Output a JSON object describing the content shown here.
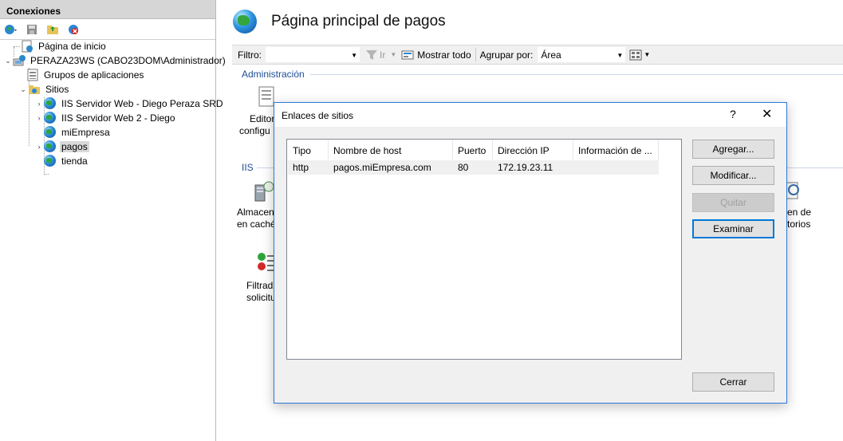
{
  "connections": {
    "header": "Conexiones",
    "tree": [
      {
        "label": "Página de inicio"
      },
      {
        "label": "PERAZA23WS (CABO23DOM\\Administrador)"
      },
      {
        "label": "Grupos de aplicaciones"
      },
      {
        "label": "Sitios"
      },
      {
        "label": "IIS Servidor Web - Diego Peraza SRD"
      },
      {
        "label": "IIS Servidor Web 2 - Diego"
      },
      {
        "label": "miEmpresa"
      },
      {
        "label": "pagos"
      },
      {
        "label": "tienda"
      }
    ]
  },
  "main": {
    "title": "Página principal de pagos",
    "filter_label": "Filtro:",
    "go_label": "Ir",
    "show_all_label": "Mostrar todo",
    "group_by_label": "Agrupar por:",
    "group_by_value": "Área",
    "sections": {
      "admin": "Administración",
      "iis": "IIS"
    },
    "features": {
      "editor_1": "Editor",
      "editor_2": "configu",
      "cache_1": "Almacen",
      "cache_2": "en caché",
      "filter_1": "Filtrad",
      "filter_2": "solicitu",
      "dir_1": "en de",
      "dir_2": "torios"
    }
  },
  "dialog": {
    "title": "Enlaces de sitios",
    "help": "?",
    "close": "✕",
    "columns": [
      "Tipo",
      "Nombre de host",
      "Puerto",
      "Dirección IP",
      "Información de ..."
    ],
    "rows": [
      [
        "http",
        "pagos.miEmpresa.com",
        "80",
        "172.19.23.11",
        ""
      ]
    ],
    "buttons": {
      "add": "Agregar...",
      "edit": "Modificar...",
      "remove": "Quitar",
      "browse": "Examinar",
      "close": "Cerrar"
    }
  }
}
